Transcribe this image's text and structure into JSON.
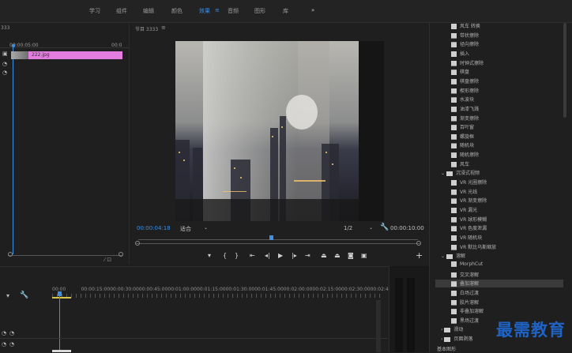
{
  "workspaces": [
    "学习",
    "组件",
    "编辑",
    "颜色",
    "效果",
    "音频",
    "图形",
    "库",
    "»"
  ],
  "workspace_active_index": 4,
  "effects_menu_glyph": "≡",
  "source": {
    "panel_label": "333",
    "timecode": "00:00:05:00",
    "end_time": "00:0",
    "clip_name": "222.jpg"
  },
  "program": {
    "title": "节目 3333",
    "menu_glyph": "≡",
    "current_time": "00:00:04:18",
    "fit": "适合",
    "quality": "1/2",
    "duration": "00:00:10:00"
  },
  "effects_list": [
    {
      "label": "风车 转换",
      "type": "item"
    },
    {
      "label": "带状擦除",
      "type": "item"
    },
    {
      "label": "径向擦除",
      "type": "item"
    },
    {
      "label": "插入",
      "type": "item"
    },
    {
      "label": "时钟式擦除",
      "type": "item"
    },
    {
      "label": "棋盘",
      "type": "item"
    },
    {
      "label": "棋盘擦除",
      "type": "item"
    },
    {
      "label": "楔形擦除",
      "type": "item"
    },
    {
      "label": "水波块",
      "type": "item"
    },
    {
      "label": "油漆飞溅",
      "type": "item"
    },
    {
      "label": "渐变擦除",
      "type": "item"
    },
    {
      "label": "百叶窗",
      "type": "item"
    },
    {
      "label": "螺旋框",
      "type": "item"
    },
    {
      "label": "随机块",
      "type": "item"
    },
    {
      "label": "随机擦除",
      "type": "item"
    },
    {
      "label": "风车",
      "type": "item"
    },
    {
      "label": "沉浸式视频",
      "type": "folder"
    },
    {
      "label": "VR 光圈擦除",
      "type": "item"
    },
    {
      "label": "VR 光线",
      "type": "item"
    },
    {
      "label": "VR 渐变擦除",
      "type": "item"
    },
    {
      "label": "VR 漏光",
      "type": "item"
    },
    {
      "label": "VR 球形模糊",
      "type": "item"
    },
    {
      "label": "VR 色度泄漏",
      "type": "item"
    },
    {
      "label": "VR 随机块",
      "type": "item"
    },
    {
      "label": "VR 默比乌斯缩放",
      "type": "item"
    },
    {
      "label": "溶解",
      "type": "folder"
    },
    {
      "label": "MorphCut",
      "type": "item"
    },
    {
      "label": "交叉溶解",
      "type": "item"
    },
    {
      "label": "叠加溶解",
      "type": "item",
      "selected": true
    },
    {
      "label": "白场过渡",
      "type": "item"
    },
    {
      "label": "胶片溶解",
      "type": "item"
    },
    {
      "label": "非叠加溶解",
      "type": "item"
    },
    {
      "label": "黑场过渡",
      "type": "item"
    },
    {
      "label": "滑动",
      "type": "folder-collapsed"
    },
    {
      "label": "页面剥落",
      "type": "folder-collapsed"
    }
  ],
  "effects_footer": "基本图形",
  "timeline": {
    "ticks": [
      "00:00",
      "00:00:15:00",
      "00:00:30:00",
      "00:00:45:00",
      "00:01:00:00",
      "00:01:15:00",
      "00:01:30:00",
      "00:01:45:00",
      "00:02:00:00",
      "00:02:15:00",
      "00:02:30:00",
      "00:02:45:0"
    ]
  },
  "watermark": "最需教育"
}
